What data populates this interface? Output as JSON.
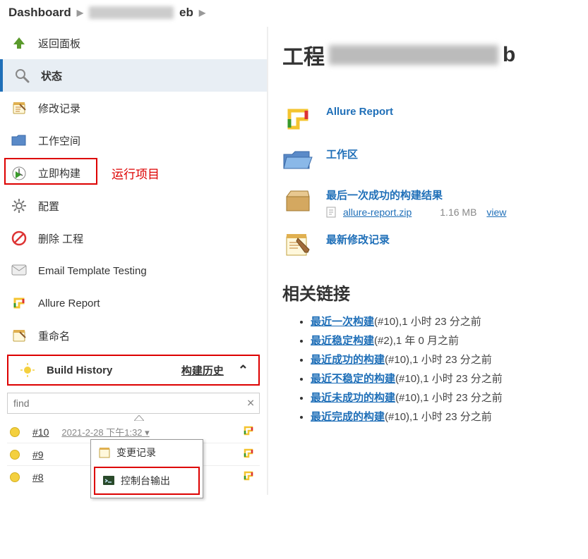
{
  "breadcrumbs": {
    "dashboard": "Dashboard",
    "tail": "eb"
  },
  "sidebar": {
    "items": [
      {
        "label": "返回面板",
        "name": "up-to-dashboard"
      },
      {
        "label": "状态",
        "name": "status",
        "active": true
      },
      {
        "label": "修改记录",
        "name": "changes"
      },
      {
        "label": "工作空间",
        "name": "workspace"
      },
      {
        "label": "立即构建",
        "name": "build-now",
        "annot": "运行项目",
        "boxed": true
      },
      {
        "label": "配置",
        "name": "configure"
      },
      {
        "label": "删除 工程",
        "name": "delete-project"
      },
      {
        "label": "Email Template Testing",
        "name": "email-template-testing"
      },
      {
        "label": "Allure Report",
        "name": "allure-report"
      },
      {
        "label": "重命名",
        "name": "rename"
      }
    ],
    "build_history": {
      "title": "Build History",
      "right": "构建历史",
      "find_placeholder": "find",
      "rows": [
        {
          "num": "#10",
          "time": "2021-2-28 下午1:32"
        },
        {
          "num": "#9",
          "time": ""
        },
        {
          "num": "#8",
          "time": ""
        }
      ],
      "menu": {
        "item1": "变更记录",
        "item2": "控制台输出"
      }
    }
  },
  "main": {
    "title_prefix": "工程",
    "title_suffix": "b",
    "info": {
      "allure": "Allure Report",
      "workspace": "工作区",
      "last_success": "最后一次成功的构建结果",
      "artifact_name": "allure-report.zip",
      "artifact_size": "1.16 MB",
      "view": "view",
      "recent_changes": "最新修改记录"
    },
    "links_header": "相关链接",
    "links": [
      {
        "a": "最近一次构建",
        "rest": "(#10),1 小时 23 分之前"
      },
      {
        "a": "最近稳定构建",
        "rest": "(#2),1 年 0 月之前"
      },
      {
        "a": "最近成功的构建",
        "rest": "(#10),1 小时 23 分之前"
      },
      {
        "a": "最近不稳定的构建",
        "rest": "(#10),1 小时 23 分之前"
      },
      {
        "a": "最近未成功的构建",
        "rest": "(#10),1 小时 23 分之前"
      },
      {
        "a": "最近完成的构建",
        "rest": "(#10),1 小时 23 分之前"
      }
    ]
  }
}
